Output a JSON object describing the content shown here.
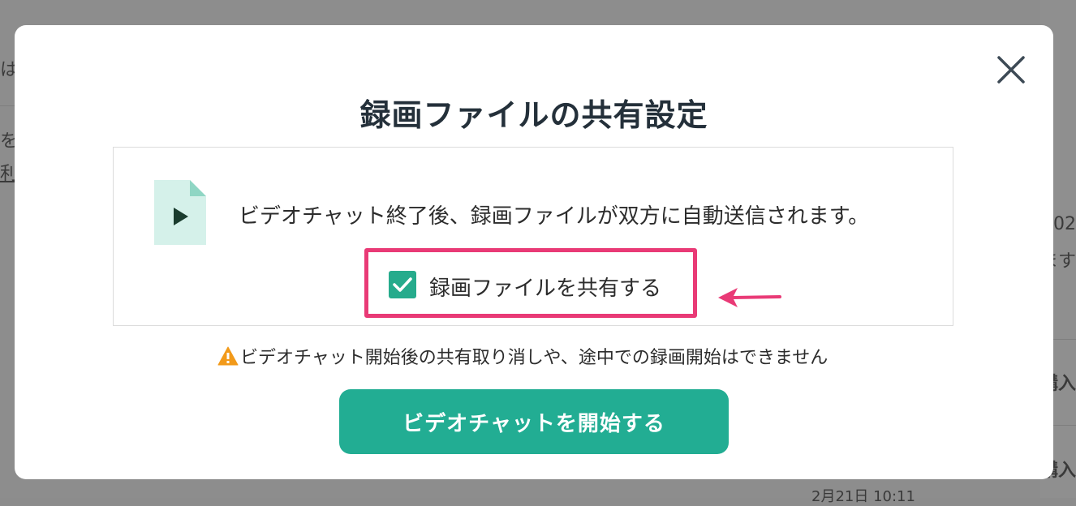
{
  "background": {
    "left_fragments": [
      "は",
      "を",
      "利"
    ],
    "right_fragments": [
      "02",
      "ます",
      "購入",
      "購入"
    ],
    "bottom_fragment": "2月21日 10:11"
  },
  "modal": {
    "title": "録画ファイルの共有設定",
    "close_icon": "close-icon",
    "info_text": "ビデオチャット終了後、録画ファイルが双方に自動送信されます。",
    "file_icon": "video-file-icon",
    "checkbox": {
      "label": "録画ファイルを共有する",
      "checked": true
    },
    "warning_text": "ビデオチャット開始後の共有取り消しや、途中での録画開始はできません",
    "start_button_label": "ビデオチャットを開始する"
  },
  "colors": {
    "accent": "#22ad93",
    "highlight": "#e93a76",
    "warning": "#f29a1a"
  }
}
